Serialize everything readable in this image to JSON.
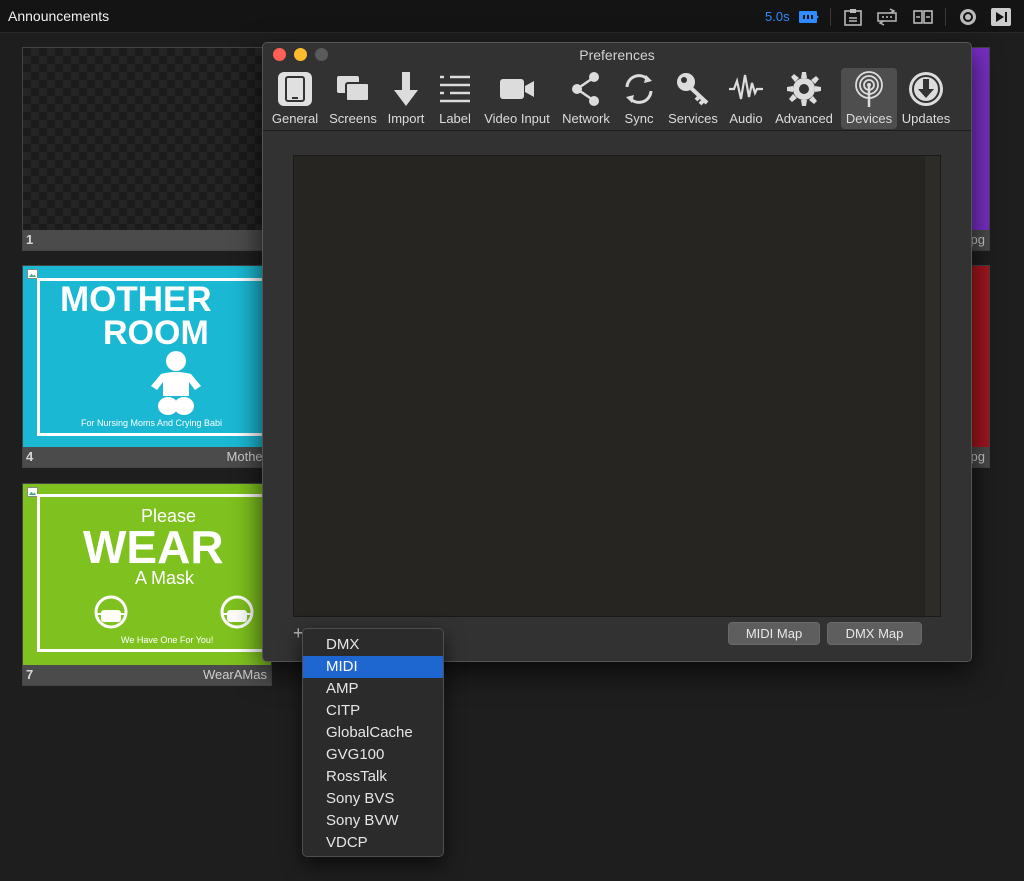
{
  "topbar": {
    "title": "Announcements",
    "timer": "5.0s",
    "icons": [
      "loop-icon",
      "clipboard-icon",
      "transition-icon",
      "split-icon",
      "record-icon",
      "play-next-icon"
    ]
  },
  "slides": [
    {
      "number": "1",
      "name": ""
    },
    {
      "number": "4",
      "name": "Mother",
      "sign": {
        "line1": "MOTHER",
        "line2": "ROOM",
        "footer": "For Nursing Moms And Crying Babi"
      }
    },
    {
      "number": "7",
      "name": "WearAMas",
      "sign": {
        "line1": "Please",
        "line2": "WEAR",
        "line3": "A Mask",
        "footer": "We Have One For You!"
      }
    }
  ],
  "right_slides": [
    {
      "name": "pg"
    },
    {
      "name": "pg"
    }
  ],
  "preferences": {
    "title": "Preferences",
    "tabs": [
      {
        "label": "General",
        "icon": "tablet-icon"
      },
      {
        "label": "Screens",
        "icon": "screens-icon"
      },
      {
        "label": "Import",
        "icon": "import-arrow-icon"
      },
      {
        "label": "Label",
        "icon": "label-list-icon"
      },
      {
        "label": "Video Input",
        "icon": "video-camera-icon"
      },
      {
        "label": "Network",
        "icon": "share-network-icon"
      },
      {
        "label": "Sync",
        "icon": "sync-icon"
      },
      {
        "label": "Services",
        "icon": "key-icon"
      },
      {
        "label": "Audio",
        "icon": "audio-wave-icon"
      },
      {
        "label": "Advanced",
        "icon": "gear-icon"
      },
      {
        "label": "Devices",
        "icon": "antenna-icon"
      },
      {
        "label": "Updates",
        "icon": "download-circle-icon"
      }
    ],
    "active_tab": "Devices",
    "buttons": {
      "add": "+",
      "midi_map": "MIDI Map",
      "dmx_map": "DMX Map"
    }
  },
  "device_menu": {
    "items": [
      "DMX",
      "MIDI",
      "AMP",
      "CITP",
      "GlobalCache",
      "GVG100",
      "RossTalk",
      "Sony BVS",
      "Sony BVW",
      "VDCP"
    ],
    "selected": "MIDI"
  },
  "colors": {
    "accent_blue": "#1e66d0",
    "timer_blue": "#2f8cff",
    "mother_room_bg": "#1bb8d4",
    "wear_mask_bg": "#7fc21f",
    "purple_slide": "#7a2fc9",
    "red_slide": "#a5161f"
  }
}
